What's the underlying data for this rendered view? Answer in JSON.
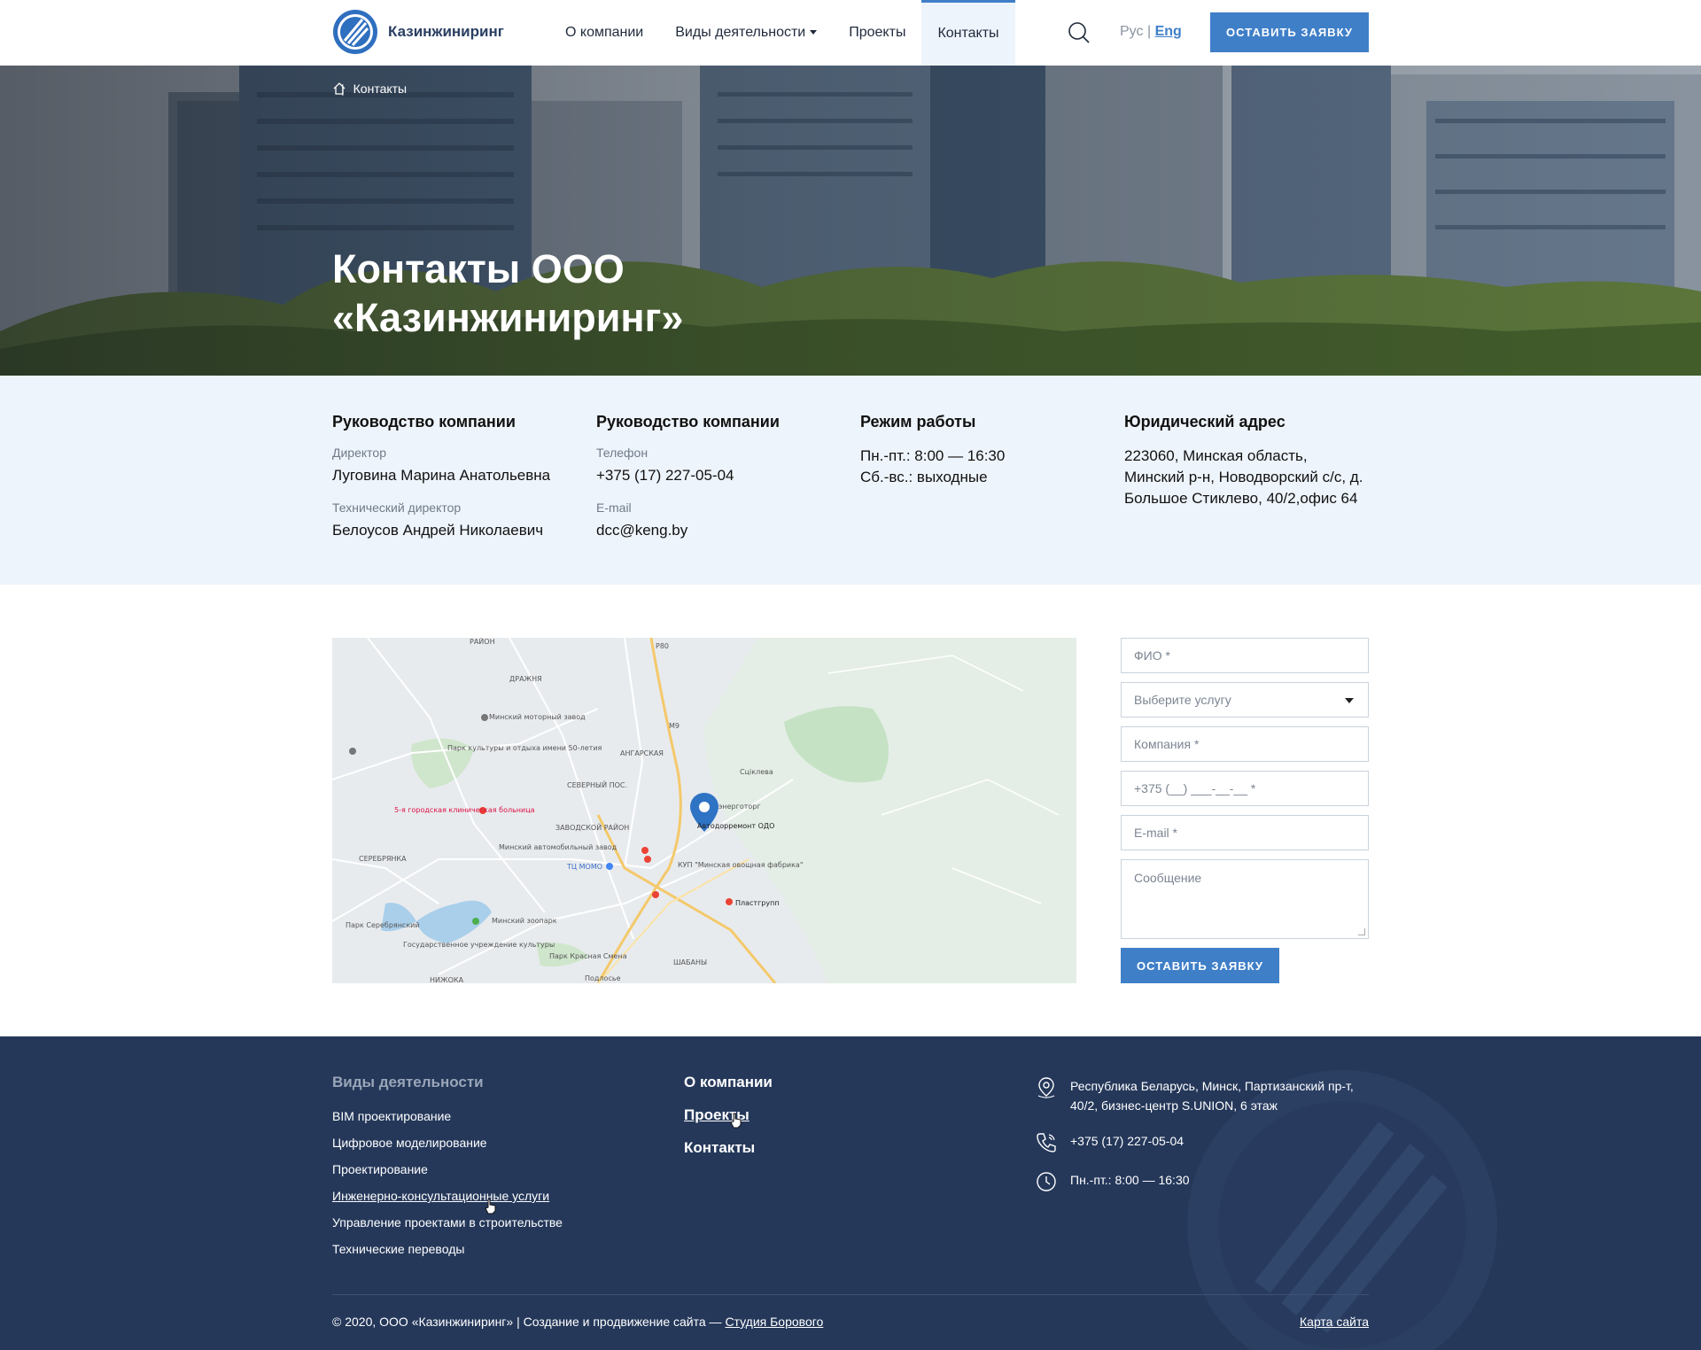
{
  "header": {
    "logo_text": "Казинжиниринг",
    "nav": [
      {
        "label": "О компании",
        "name": "nav-about"
      },
      {
        "label": "Виды деятельности",
        "name": "nav-activities"
      },
      {
        "label": "Проекты",
        "name": "nav-projects"
      },
      {
        "label": "Контакты",
        "name": "nav-contacts"
      }
    ],
    "lang_ru": "Рус",
    "lang_sep": "|",
    "lang_en": "Eng",
    "cta": "ОСТАВИТЬ ЗАЯВКУ"
  },
  "hero": {
    "breadcrumb_sep": "|",
    "breadcrumb_current": "Контакты",
    "title": "Контакты ООО «Казинжиниринг»"
  },
  "info": {
    "col1": {
      "heading": "Руководство компании",
      "label1": "Директор",
      "value1": "Луговина Марина Анатольевна",
      "label2": "Технический директор",
      "value2": "Белоусов Андрей Николаевич"
    },
    "col2": {
      "heading": "Руководство компании",
      "label1": "Телефон",
      "value1": "+375 (17) 227-05-04",
      "label2": "E-mail",
      "value2": "dcc@keng.by"
    },
    "col3": {
      "heading": "Режим работы",
      "line1": "Пн.-пт.: 8:00 — 16:30",
      "line2": "Сб.-вс.: выходные"
    },
    "col4": {
      "heading": "Юридический адрес",
      "address": "223060, Минская область, Минский р-н, Новодворский с/с, д. Большое Стиклево, 40/2,офис 64"
    }
  },
  "map": {
    "labels": {
      "l1": "РАЙОН",
      "l2": "ДРАЖНЯ",
      "l3": "Минский моторный завод",
      "l4": "Парк культуры и отдыха имени 50-летия",
      "l5": "АНГАРСКАЯ",
      "l6": "Сцiклева",
      "l7": "СЕВЕРНЫЙ ПОС.",
      "l8": "5-я городская клиническая больница",
      "l9": "ЗАВОДСКОЙ РАЙОН",
      "l10": "энерготорг",
      "l11": "Автодорремонт ОДО",
      "l12": "СЕРЕБРЯНКА",
      "l13": "Минский автомобильный завод",
      "l14": "ТЦ MOMO",
      "l15": "КУП \"Минская овощная фабрика\"",
      "l16": "Пластгрупп",
      "l17": "Минский зоопарк",
      "l18": "Парк Серебрянский",
      "l19": "Парк Красная Смена",
      "l20": "Государственное учреждение культуры",
      "l21": "ШАБАНЫ",
      "l22": "Подлосье",
      "l23": "НИЖОКА",
      "l24": "М9",
      "l25": "Р80"
    }
  },
  "form": {
    "fio": "ФИО *",
    "service": "Выберите услугу",
    "company": "Компания *",
    "phone": "+375 (__) ___-__-__ *",
    "email": "E-mail *",
    "message": "Сообщение",
    "submit": "ОСТАВИТЬ ЗАЯВКУ"
  },
  "footer": {
    "activities_heading": "Виды деятельности",
    "activities": [
      "BIM проектирование",
      "Цифровое моделирование",
      "Проектирование",
      "Инженерно-консультационные услуги",
      "Управление проектами в строительстве",
      "Технические переводы"
    ],
    "links": [
      "О компании",
      "Проекты",
      "Контакты"
    ],
    "address": "Республика Беларусь, Минск, Партизанский пр-т, 40/2, бизнес-центр S.UNION, 6 этаж",
    "phone": "+375 (17) 227-05-04",
    "hours": "Пн.-пт.: 8:00 — 16:30",
    "copyright": "© 2020, ООО «Казинжиниринг»  |  Создание и продвижение сайта — ",
    "studio": "Студия Борового",
    "sitemap": "Карта сайта"
  },
  "colors": {
    "accent": "#3f7fc8",
    "footer_bg": "#25385a",
    "info_bg": "#eef4fb"
  }
}
